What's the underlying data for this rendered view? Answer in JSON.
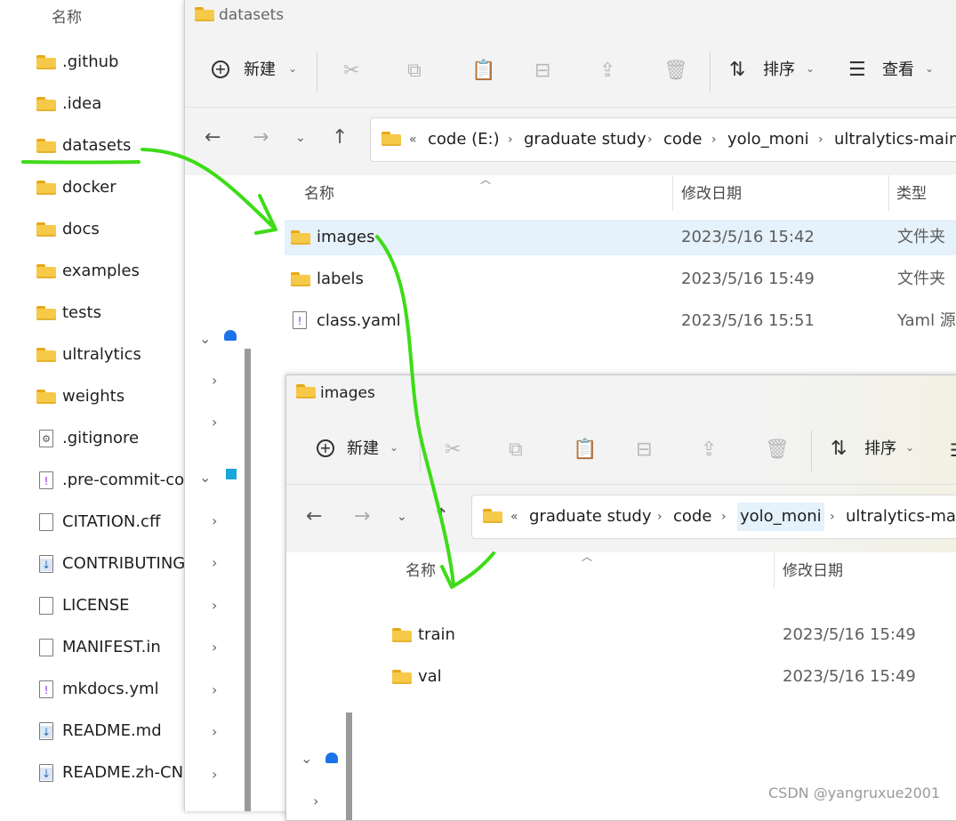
{
  "left_pane": {
    "header": "名称",
    "items": [
      {
        "label": ".github",
        "icon": "folder-icon"
      },
      {
        "label": ".idea",
        "icon": "folder-icon"
      },
      {
        "label": "datasets",
        "icon": "folder-icon"
      },
      {
        "label": "docker",
        "icon": "folder-icon"
      },
      {
        "label": "docs",
        "icon": "folder-icon"
      },
      {
        "label": "examples",
        "icon": "folder-icon"
      },
      {
        "label": "tests",
        "icon": "folder-icon"
      },
      {
        "label": "ultralytics",
        "icon": "folder-icon"
      },
      {
        "label": "weights",
        "icon": "folder-icon"
      },
      {
        "label": ".gitignore",
        "icon": "gear-file-icon"
      },
      {
        "label": ".pre-commit-co",
        "icon": "yaml-file-icon"
      },
      {
        "label": "CITATION.cff",
        "icon": "file-icon"
      },
      {
        "label": "CONTRIBUTING",
        "icon": "markdown-file-icon"
      },
      {
        "label": "LICENSE",
        "icon": "file-icon"
      },
      {
        "label": "MANIFEST.in",
        "icon": "file-icon"
      },
      {
        "label": "mkdocs.yml",
        "icon": "yaml-file-icon"
      },
      {
        "label": "README.md",
        "icon": "markdown-file-icon"
      },
      {
        "label": "README.zh-CN",
        "icon": "markdown-file-icon"
      }
    ]
  },
  "window1": {
    "title": "datasets",
    "toolbar": {
      "new_label": "新建",
      "sort_label": "排序",
      "view_label": "查看"
    },
    "breadcrumb": [
      "code (E:)",
      "graduate study",
      "code",
      "yolo_moni",
      "ultralytics-main"
    ],
    "columns": {
      "name": "名称",
      "modified": "修改日期",
      "type": "类型"
    },
    "files": [
      {
        "name": "images",
        "modified": "2023/5/16 15:42",
        "type": "文件夹",
        "selected": true
      },
      {
        "name": "labels",
        "modified": "2023/5/16 15:49",
        "type": "文件夹"
      },
      {
        "name": "class.yaml",
        "modified": "2023/5/16 15:51",
        "type": "Yaml 源"
      }
    ]
  },
  "window2": {
    "title": "images",
    "toolbar": {
      "new_label": "新建",
      "sort_label": "排序"
    },
    "breadcrumb": [
      "graduate study",
      "code",
      "yolo_moni",
      "ultralytics-mai"
    ],
    "columns": {
      "name": "名称",
      "modified": "修改日期"
    },
    "files": [
      {
        "name": "train",
        "modified": "2023/5/16 15:49"
      },
      {
        "name": "val",
        "modified": "2023/5/16 15:49"
      }
    ]
  },
  "watermark": "CSDN @yangruxue2001",
  "colors": {
    "annotation": "#3ddc17",
    "folder": "#f7c948",
    "selection": "#e5f1fb"
  }
}
